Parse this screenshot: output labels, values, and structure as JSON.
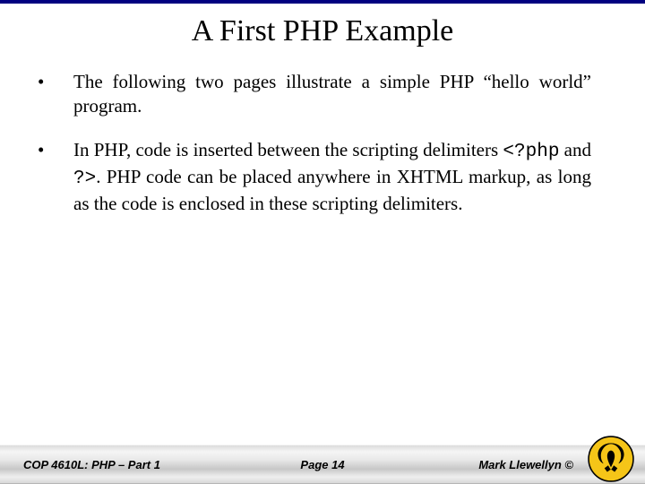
{
  "title": "A First PHP Example",
  "bullets": [
    {
      "parts": [
        {
          "text": "The following two pages illustrate a simple PHP “hello world” program.",
          "mono": false
        }
      ]
    },
    {
      "parts": [
        {
          "text": "In PHP, code is inserted between the scripting delimiters ",
          "mono": false
        },
        {
          "text": "<?php",
          "mono": true
        },
        {
          "text": " and ",
          "mono": false
        },
        {
          "text": "?>",
          "mono": true
        },
        {
          "text": ".  PHP code can be placed anywhere in XHTML markup, as long as the code is enclosed in these scripting delimiters.",
          "mono": false
        }
      ]
    }
  ],
  "footer": {
    "left": "COP 4610L: PHP – Part 1",
    "center": "Page 14",
    "right": "Mark Llewellyn ©"
  },
  "logo": {
    "name": "ucf-pegasus"
  }
}
